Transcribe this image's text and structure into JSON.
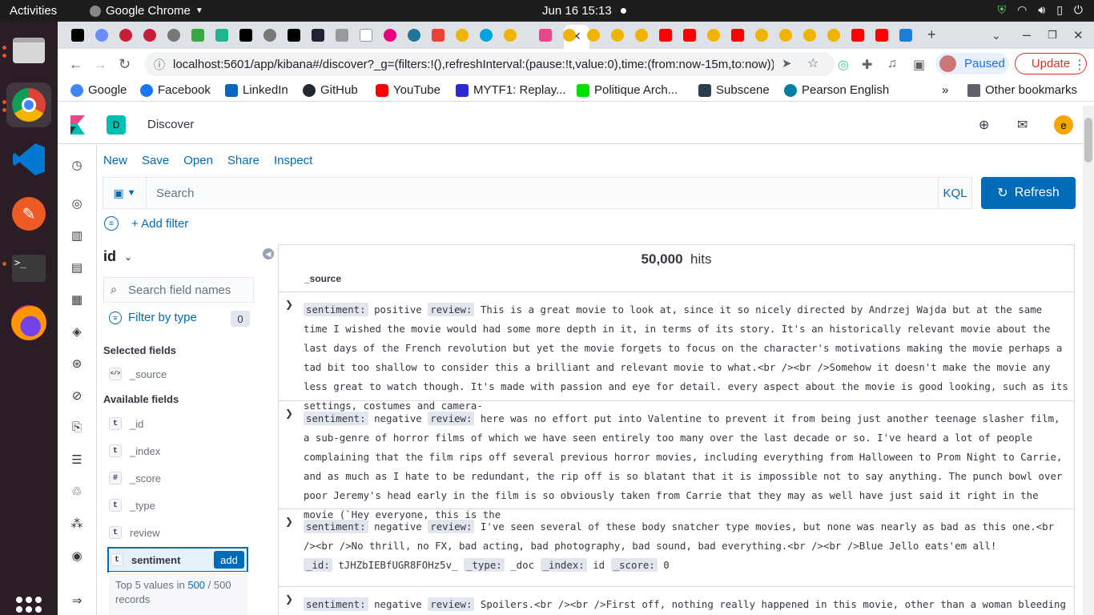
{
  "os": {
    "activities": "Activities",
    "app_name": "Google Chrome",
    "clock": "Jun 16  15:13"
  },
  "browser": {
    "url": "localhost:5601/app/kibana#/discover?_g=(filters:!(),refreshInterval:(pause:!t,value:0),time:(from:now-15m,to:now))&_...",
    "profile_status": "Paused",
    "update_label": "Update",
    "bookmarks": [
      {
        "label": "Google",
        "color": "#4285f4"
      },
      {
        "label": "Facebook",
        "color": "#1877f2"
      },
      {
        "label": "LinkedIn",
        "color": "#0a66c2"
      },
      {
        "label": "GitHub",
        "color": "#24292f"
      },
      {
        "label": "YouTube",
        "color": "#ff0000"
      },
      {
        "label": "MYTF1: Replay...",
        "color": "#2b2bd6"
      },
      {
        "label": "Politique Arch...",
        "color": "#00e000"
      },
      {
        "label": "Subscene",
        "color": "#2c3e50"
      },
      {
        "label": "Pearson English",
        "color": "#007fa3"
      }
    ],
    "more_bookmarks": "»",
    "other_bookmarks": "Other bookmarks"
  },
  "kibana": {
    "space_initial": "D",
    "app_title": "Discover",
    "user_initial": "e",
    "topnav": [
      "New",
      "Save",
      "Open",
      "Share",
      "Inspect"
    ],
    "search_placeholder": "Search",
    "kql_label": "KQL",
    "refresh_label": "Refresh",
    "add_filter_label": "+ Add filter",
    "index_pattern": "id",
    "field_search_placeholder": "Search field names",
    "filter_by_type_label": "Filter by type",
    "filter_count": "0",
    "selected_fields_title": "Selected fields",
    "selected_fields": [
      {
        "type": "</>",
        "name": "_source"
      }
    ],
    "available_fields_title": "Available fields",
    "available_fields": [
      {
        "type": "t",
        "name": "_id"
      },
      {
        "type": "t",
        "name": "_index"
      },
      {
        "type": "#",
        "name": "_score"
      },
      {
        "type": "t",
        "name": "_type"
      },
      {
        "type": "t",
        "name": "review"
      },
      {
        "type": "t",
        "name": "sentiment"
      }
    ],
    "add_button_label": "add",
    "details": {
      "prefix": "Top 5 values in ",
      "shown": "500",
      "sep": " / ",
      "total": "500",
      "suffix": " records"
    },
    "hits_count": "50,000",
    "hits_label": "hits",
    "column_header": "_source",
    "documents": [
      {
        "sentiment": "positive",
        "review": "This is a great movie to look at, since it so nicely directed by Andrzej Wajda but at the same time I wished the movie would had some more depth in it, in terms of its story. It's an historically relevant movie about the last days of the French revolution but yet the movie forgets to focus on the character's motivations making the movie perhaps a tad bit too shallow to consider this a brilliant and relevant movie to what.<br /><br />Somehow it doesn't make the movie any less great to watch though. It's made with passion and eye for detail. every aspect about the movie is good looking, such as its settings, costumes and camera-"
      },
      {
        "sentiment": "negative",
        "review": "here was no effort put into Valentine to prevent it from being just another teenage slasher film, a sub-genre of horror films of which we have seen entirely too many over the last decade or so. I've heard a lot of people complaining that the film rips off several previous horror movies, including everything from Halloween to Prom Night to Carrie, and as much as I hate to be redundant, the rip off is so blatant that it is impossible not to say anything. The punch bowl over poor Jeremy's head early in the film is so obviously taken from Carrie that they may as well have just said it right in the movie (`Hey everyone, this is the"
      },
      {
        "sentiment": "negative",
        "review": "I've seen several of these body snatcher type movies, but none was nearly as bad as this one.<br /><br />No thrill, no FX, bad acting, bad photography, bad sound, bad everything.<br /><br />Blue Jello eats'em all!",
        "_id": "tJHZbIEBfUGR8FOHz5v_",
        "_type": "_doc",
        "_index": "id",
        "_score": "0"
      },
      {
        "sentiment": "negative",
        "review": "Spoilers.<br /><br />First off, nothing really happened in this movie, other than a woman bleeding"
      }
    ]
  }
}
